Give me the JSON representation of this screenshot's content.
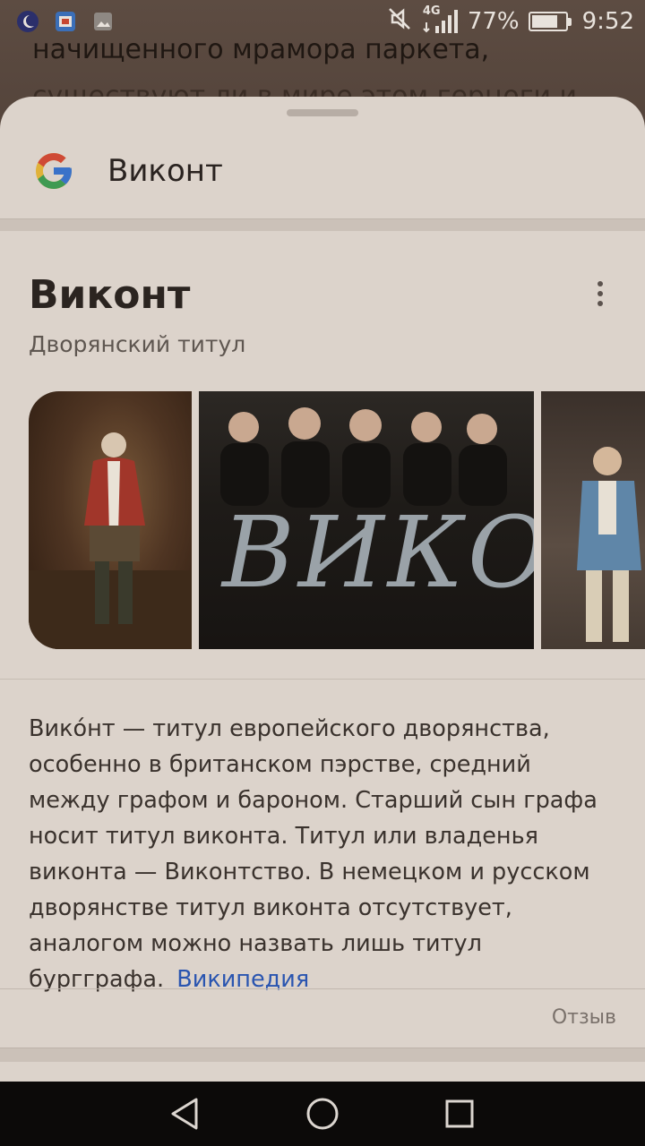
{
  "status_bar": {
    "battery_percent": "77%",
    "battery_level": 0.77,
    "network": "4G",
    "time": "9:52",
    "icons": [
      "moon-icon",
      "app-notification-icon",
      "image-notification-icon",
      "mute-icon",
      "signal-icon",
      "battery-icon"
    ]
  },
  "background_app": {
    "line1": "начищенного мрамора паркета,",
    "line2": "существуют ли в мире этом герцоги и"
  },
  "search": {
    "logo": "google-g-icon",
    "query": "Виконт"
  },
  "knowledge_panel": {
    "title": "Виконт",
    "subtitle": "Дворянский титул",
    "more_icon": "more-vert-icon",
    "images": [
      {
        "name": "portrait-image",
        "caption": ""
      },
      {
        "name": "band-image",
        "caption": "ВИКОНТ"
      },
      {
        "name": "period-drama-image",
        "caption": ""
      }
    ],
    "description": "Вико́нт — титул европейского дворянства, особенно в британском пэрстве, средний между графом и бароном. Старший сын графа носит титул виконта. Титул или владенья виконта — Виконтство. В немецком и русском дворянстве титул виконта отсутствует, аналогом можно назвать лишь титул бургграфа.",
    "source_link": "Википедия",
    "feedback": "Отзыв"
  },
  "navigation": {
    "back": "back-icon",
    "home": "home-icon",
    "recents": "recents-icon"
  },
  "colors": {
    "sheet_background": "#dcd3cb",
    "link": "#2a55b0",
    "navbar": "#0c0a09"
  }
}
